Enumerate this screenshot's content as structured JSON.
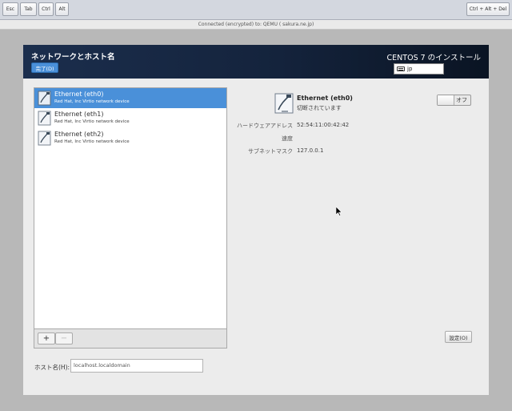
{
  "vnc": {
    "keys": [
      "Esc",
      "Tab",
      "Ctrl",
      "Alt"
    ],
    "cad": "Ctrl + Alt + Del",
    "status": "Connected (encrypted) to: QEMU (                  sakura.ne.jp)"
  },
  "header": {
    "title": "ネットワークとホスト名",
    "done": "完了(D)",
    "install_title": "CENTOS 7 のインストール",
    "keyboard_layout": "jp"
  },
  "devices": [
    {
      "name": "Ethernet (eth0)",
      "desc": "Red Hat, Inc Virtio network device",
      "selected": true
    },
    {
      "name": "Ethernet (eth1)",
      "desc": "Red Hat, Inc Virtio network device",
      "selected": false
    },
    {
      "name": "Ethernet (eth2)",
      "desc": "Red Hat, Inc Virtio network device",
      "selected": false
    }
  ],
  "toolbar": {
    "add": "+",
    "remove": "−"
  },
  "detail": {
    "name": "Ethernet (eth0)",
    "status": "切断されています",
    "toggle": "オフ",
    "props": [
      {
        "label": "ハードウェアアドレス",
        "value": "52:54:11:00:42:42"
      },
      {
        "label": "速度",
        "value": ""
      },
      {
        "label": "サブネットマスク",
        "value": "127.0.0.1"
      }
    ],
    "settings": "設定(O)"
  },
  "hostname": {
    "label": "ホスト名(H):",
    "value": "localhost.localdomain"
  },
  "colors": {
    "accent": "#4a90d9",
    "header": "#14233c"
  }
}
